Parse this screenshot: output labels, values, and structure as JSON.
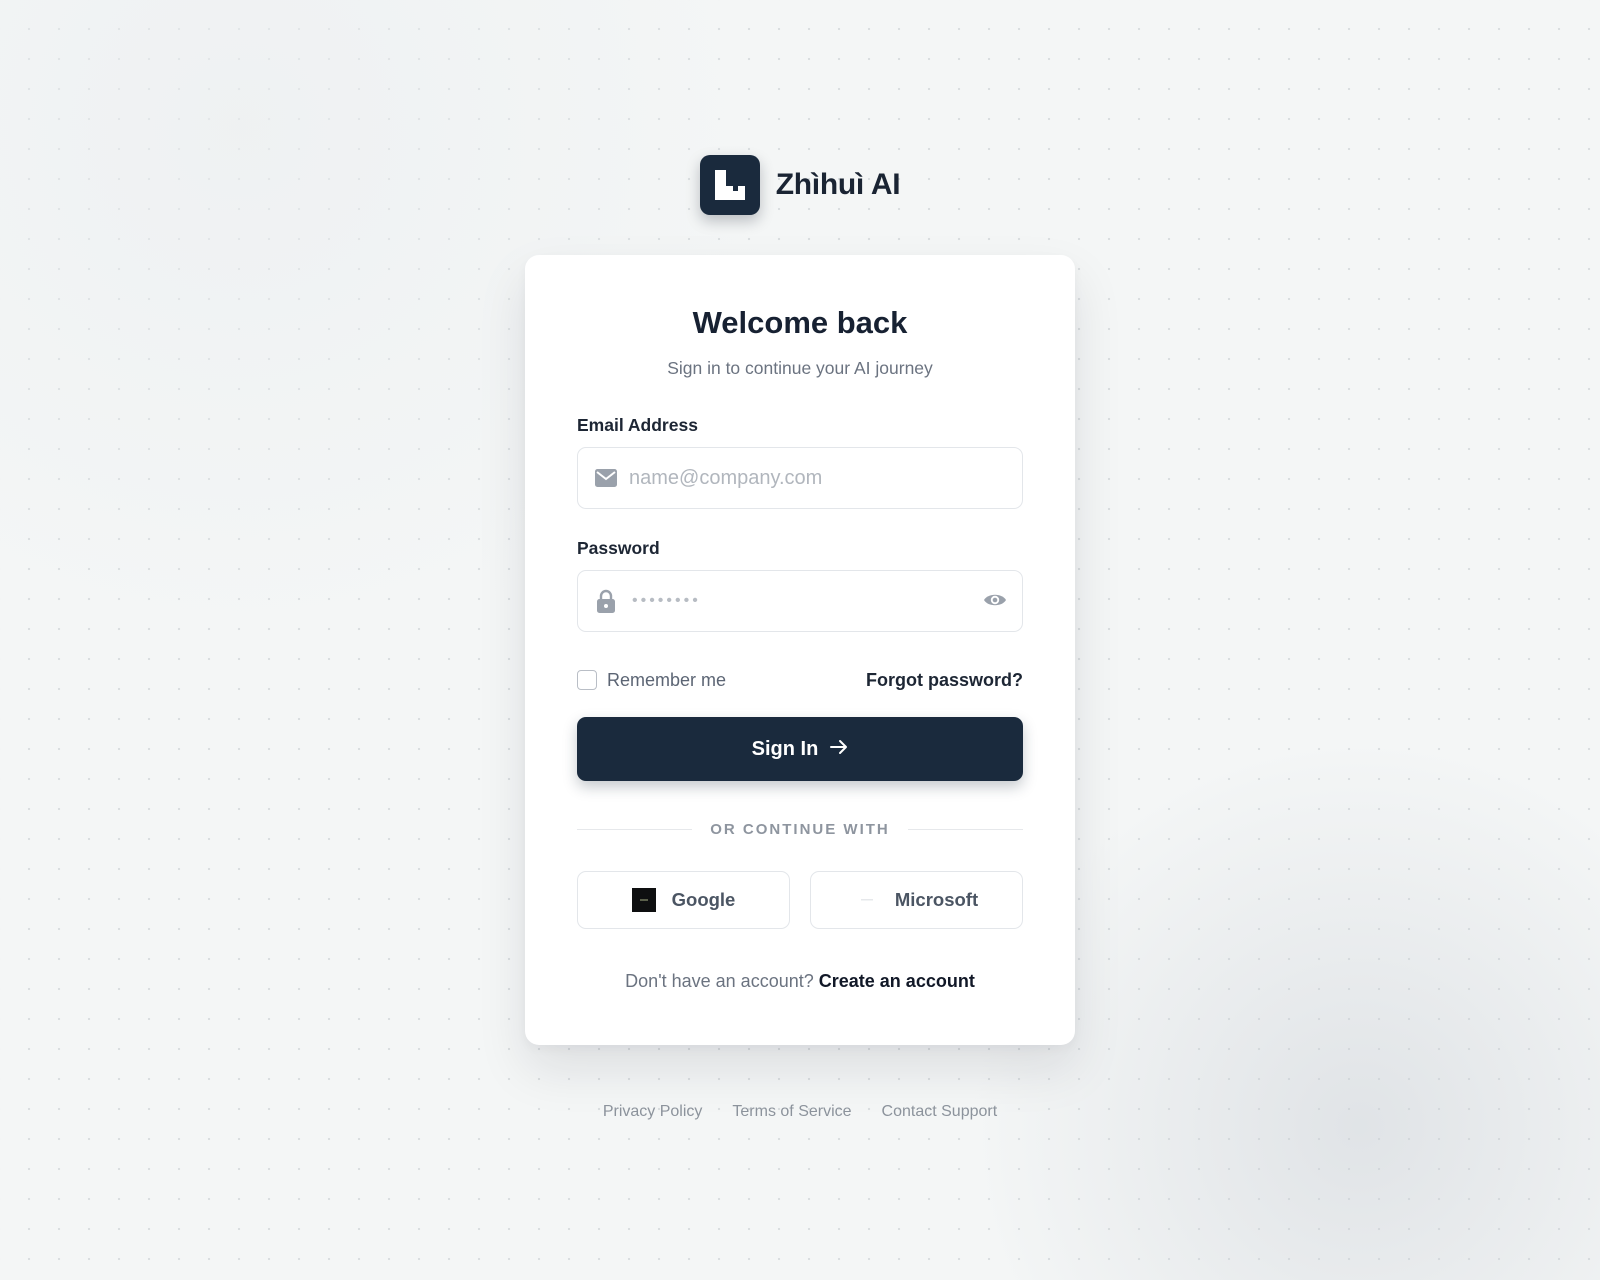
{
  "brand": {
    "name": "Zhìhuì AI",
    "logo_color": "#1a2a3d"
  },
  "card": {
    "title": "Welcome back",
    "subtitle": "Sign in to continue your AI journey",
    "email": {
      "label": "Email Address",
      "placeholder": "name@company.com",
      "value": "",
      "icon": "mail-icon"
    },
    "password": {
      "label": "Password",
      "masked_placeholder": "••••••••",
      "icon": "lock-icon",
      "toggle_icon": "eye-icon"
    },
    "remember_me": {
      "label": "Remember me",
      "checked": false
    },
    "forgot_password": "Forgot password?",
    "sign_in_label": "Sign In",
    "divider_label": "OR CONTINUE WITH",
    "social": {
      "google_label": "Google",
      "microsoft_label": "Microsoft"
    },
    "signup": {
      "prompt": "Don't have an account?",
      "link": "Create an account"
    }
  },
  "footer": {
    "links": [
      "Privacy Policy",
      "Terms of Service",
      "Contact Support"
    ]
  },
  "colors": {
    "primary": "#1a2a3d",
    "background": "#f4f6f6",
    "muted_text": "#6b7380"
  }
}
